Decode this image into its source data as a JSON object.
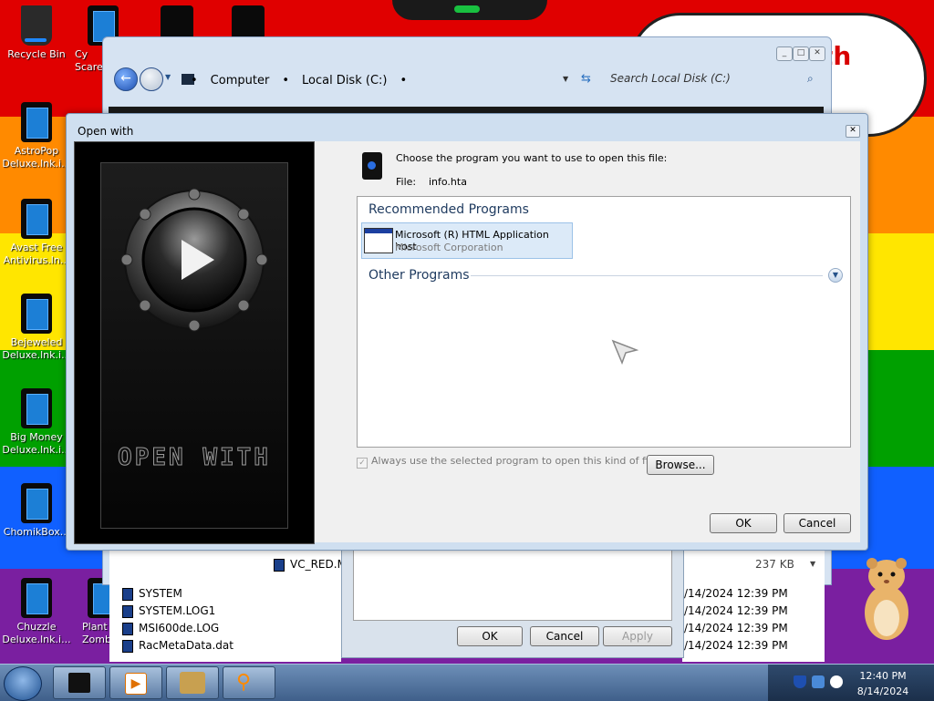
{
  "desktop": {
    "icons": [
      {
        "label": "Recycle Bin"
      },
      {
        "label": "AstroPop Deluxe.lnk.i..."
      },
      {
        "label": "Avast Free Antivirus.ln..."
      },
      {
        "label": "Bejeweled Deluxe.lnk.i..."
      },
      {
        "label": "Big Money Deluxe.lnk.i..."
      },
      {
        "label": "ChomikBox..."
      },
      {
        "label": "Chuzzle Deluxe.lnk.i..."
      },
      {
        "label": "Cy Scare"
      },
      {
        "label": "Plant Zombi"
      }
    ],
    "bubble_text": "nth"
  },
  "explorer": {
    "breadcrumb": [
      "Computer",
      "Local Disk (C:)"
    ],
    "search_placeholder": "Search Local Disk (C:)",
    "files": [
      {
        "name": "VC_RED.M",
        "size": "237 KB"
      },
      {
        "name": "SYSTEM",
        "date": "/14/2024 12:39 PM"
      },
      {
        "name": "SYSTEM.LOG1",
        "date": "/14/2024 12:39 PM"
      },
      {
        "name": "MSI600de.LOG",
        "date": "/14/2024 12:39 PM"
      },
      {
        "name": "RacMetaData.dat",
        "date": "/14/2024 12:39 PM"
      }
    ]
  },
  "bg_dialog": {
    "ok": "OK",
    "cancel": "Cancel",
    "apply": "Apply"
  },
  "open_with": {
    "title": "Open with",
    "art_text": "OPEN WITH",
    "prompt": "Choose the program you want to use to open this file:",
    "file_label": "File:",
    "file_name": "info.hta",
    "recommended_header": "Recommended Programs",
    "other_header": "Other Programs",
    "recommended": [
      {
        "name": "Microsoft (R) HTML Application host",
        "vendor": "Microsoft Corporation"
      }
    ],
    "always_use": "Always use the selected program to open this kind of file",
    "browse": "Browse...",
    "ok": "OK",
    "cancel": "Cancel"
  },
  "taskbar": {
    "time": "12:40 PM",
    "date": "8/14/2024"
  },
  "colors": {
    "rainbow": [
      "#e00000",
      "#ff8a00",
      "#ffe600",
      "#00a000",
      "#1060ff",
      "#7a1fa0"
    ],
    "accent": "#1e3a5f"
  }
}
